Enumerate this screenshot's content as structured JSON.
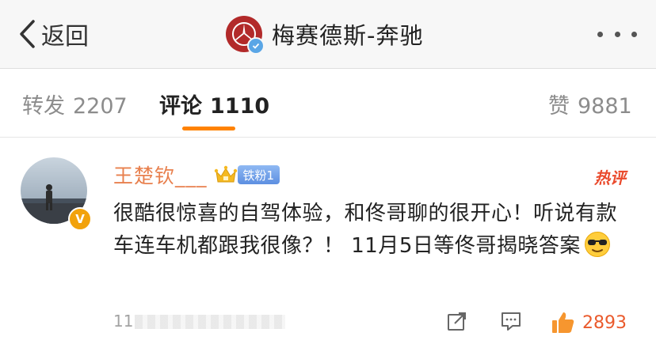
{
  "header": {
    "back_label": "返回",
    "title": "梅赛德斯-奔驰"
  },
  "tabs": [
    {
      "label": "转发",
      "count": "2207",
      "active": false
    },
    {
      "label": "评论",
      "count": "1110",
      "active": true
    },
    {
      "label": "赞",
      "count": "9881",
      "active": false
    }
  ],
  "comment": {
    "username": "王楚钦___",
    "fan_badge": "铁粉1",
    "hot_label": "热评",
    "verified_badge": "V",
    "text": "很酷很惊喜的自驾体验，和佟哥聊的很开心！听说有款车连车机都跟我很像？！ 11月5日等佟哥揭晓答案",
    "emoji": "sunglasses-emoji",
    "time": "11",
    "like_count": "2893"
  },
  "colors": {
    "accent": "#ff8200",
    "username": "#e8804e",
    "hot": "#ea4a2c",
    "like": "#ea5a2c",
    "fan_badge": "#6f9de6",
    "brand_logo": "#b22a2a"
  }
}
